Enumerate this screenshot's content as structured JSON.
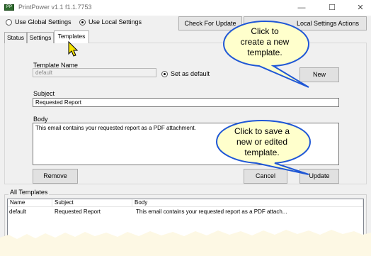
{
  "window": {
    "title": "PrintPower v1.1  f1.1.7753",
    "icon_text": "PP",
    "minimize_glyph": "—",
    "maximize_glyph": "☐",
    "close_glyph": "✕"
  },
  "settings_mode": {
    "global_label": "Use Global Settings",
    "local_label": "Use Local Settings",
    "selected": "local"
  },
  "toolbar": {
    "check_update_label": "Check For Update",
    "local_actions_label": "Local Settings Actions"
  },
  "tabs": [
    {
      "label": "Status",
      "active": false
    },
    {
      "label": "Settings",
      "active": false
    },
    {
      "label": "Templates",
      "active": true
    }
  ],
  "template_form": {
    "name_label": "Template Name",
    "name_value": "default",
    "set_default_label": "Set as default",
    "set_default_checked": true,
    "new_label": "New",
    "subject_label": "Subject",
    "subject_value": "Requested Report",
    "body_label": "Body",
    "body_value": "This email contains your requested report as a PDF attachment.",
    "remove_label": "Remove",
    "cancel_label": "Cancel",
    "update_label": "Update"
  },
  "all_templates": {
    "group_label": "All Templates",
    "columns": [
      "Name",
      "Subject",
      "Body"
    ],
    "rows": [
      {
        "name": "default",
        "subject": "Requested Report",
        "body": "This email contains your requested report as a PDF attach..."
      }
    ]
  },
  "callouts": {
    "new_line1": "Click to",
    "new_line2": "create a new",
    "new_line3": "template.",
    "update_line1": "Click to save a",
    "update_line2": "new or edited",
    "update_line3": "template."
  },
  "colors": {
    "callout_fill": "#ffffcc",
    "callout_border": "#1f57d6",
    "torn_paper": "#fdf8e4"
  }
}
